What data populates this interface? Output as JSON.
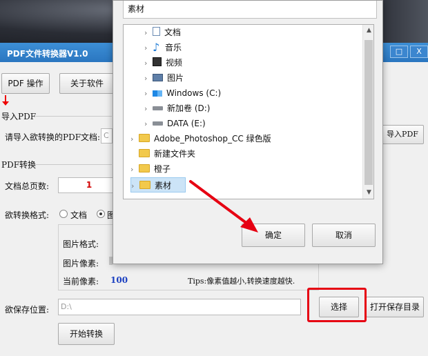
{
  "app": {
    "title": "PDF文件转换器V1.0",
    "window_buttons": {
      "maximize": "□",
      "close": "X"
    },
    "menu": {
      "pdf_ops": "PDF 操作",
      "about": "关于软件"
    },
    "import_section": {
      "group_title": "导入PDF",
      "prompt": "请导入欲转换的PDF文档:",
      "input_value": "C",
      "import_button": "导入PDF"
    },
    "convert_section": {
      "group_title": "PDF转换",
      "page_count_label": "文档总页数:",
      "page_count_value": "1",
      "format_label": "欲转换格式:",
      "format_option_doc": "文档",
      "format_option_img_partial": "图",
      "image_format_label": "图片格式:",
      "image_pixel_label": "图片像素:",
      "current_pixel_label": "当前像素:",
      "current_pixel_value": "100",
      "tips": "Tips:像素值越小,转换速度越快."
    },
    "save_section": {
      "label": "欲保存位置:",
      "path_value": "D:\\",
      "select_button": "选择",
      "open_dir_button": "打开保存目录"
    },
    "start_button": "开始转换"
  },
  "dialog": {
    "folder_field_value": "素材",
    "tree_items": [
      {
        "label": "文档",
        "icon": "document-icon"
      },
      {
        "label": "音乐",
        "icon": "music-icon"
      },
      {
        "label": "视频",
        "icon": "video-icon"
      },
      {
        "label": "图片",
        "icon": "pictures-icon"
      },
      {
        "label": "Windows (C:)",
        "icon": "windows-drive-icon"
      },
      {
        "label": "新加卷 (D:)",
        "icon": "drive-icon"
      },
      {
        "label": "DATA (E:)",
        "icon": "drive-icon"
      },
      {
        "label": "Adobe_Photoshop_CC  绿色版",
        "icon": "folder-icon"
      },
      {
        "label": "新建文件夹",
        "icon": "folder-icon"
      },
      {
        "label": "橙子",
        "icon": "folder-icon"
      },
      {
        "label": "素材",
        "icon": "folder-icon",
        "selected": true
      }
    ],
    "ok_button": "确定",
    "cancel_button": "取消"
  },
  "colors": {
    "titlebar": "#2a76c0",
    "highlight_red": "#e60012",
    "selected_row": "#cce4f7",
    "page_count": "#d20000",
    "pixel_value": "#1a3fc0"
  }
}
